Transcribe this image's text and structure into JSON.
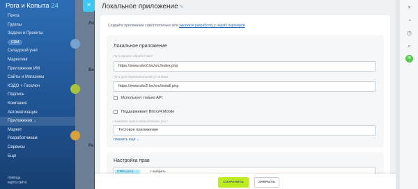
{
  "brand": {
    "name": "Рога и Копыта",
    "number": "24"
  },
  "sidebar": {
    "items": [
      {
        "label": "Почта"
      },
      {
        "label": "Группы"
      },
      {
        "label": "Задачи и Проекты"
      },
      {
        "label": "CRM",
        "badge": true
      },
      {
        "label": "Складской учет"
      },
      {
        "label": "Маркетинг"
      },
      {
        "label": "Приложение ИМ"
      },
      {
        "label": "Сайты и Магазины"
      },
      {
        "label": "КЭДО + Госключ"
      },
      {
        "label": "Подпись"
      },
      {
        "label": "Компания"
      },
      {
        "label": "Автоматизация"
      },
      {
        "label": "Приложения",
        "caret": "⌄",
        "active": true
      },
      {
        "label": "Маркет"
      },
      {
        "label": "Разработчикам"
      },
      {
        "label": "Сервисы"
      },
      {
        "label": "Ещё"
      }
    ],
    "footer": [
      "помощь",
      "карта сайта"
    ]
  },
  "mid": {
    "labels": [
      "Ло",
      "Ве",
      "Ра"
    ]
  },
  "panel": {
    "title": "Локальное приложение",
    "hint_text": "Создайте приложение самостоятельно или ",
    "hint_link": "закажите разработку у наших партнеров",
    "section_main": {
      "title": "Локальное приложение",
      "handler_label": "Путь вашего обработчика*",
      "handler_value": "https://www.site2.loc/src/index.php",
      "install_label": "Путь для первоначальной установки",
      "install_value": "https://www.site2.loc/src/install.php",
      "api_only": "Использует только API",
      "mobile": "Поддерживает Bitrix24.Mobile",
      "menu_label": "Название пункта меню Russian (ru) *",
      "menu_value": "Тестовое приложение",
      "show_more": "показать ещё"
    },
    "section_rights": {
      "title": "Настройка прав",
      "chip": "CRM (crm)",
      "chip_close": "×",
      "add": "+ выбрать"
    },
    "buttons": {
      "save": "СОХРАНИТЬ",
      "close": "ЗАКРЫТЬ"
    }
  },
  "colors": {
    "save": "#bbed21",
    "accent": "#3bc8f5",
    "link": "#2067b0"
  }
}
